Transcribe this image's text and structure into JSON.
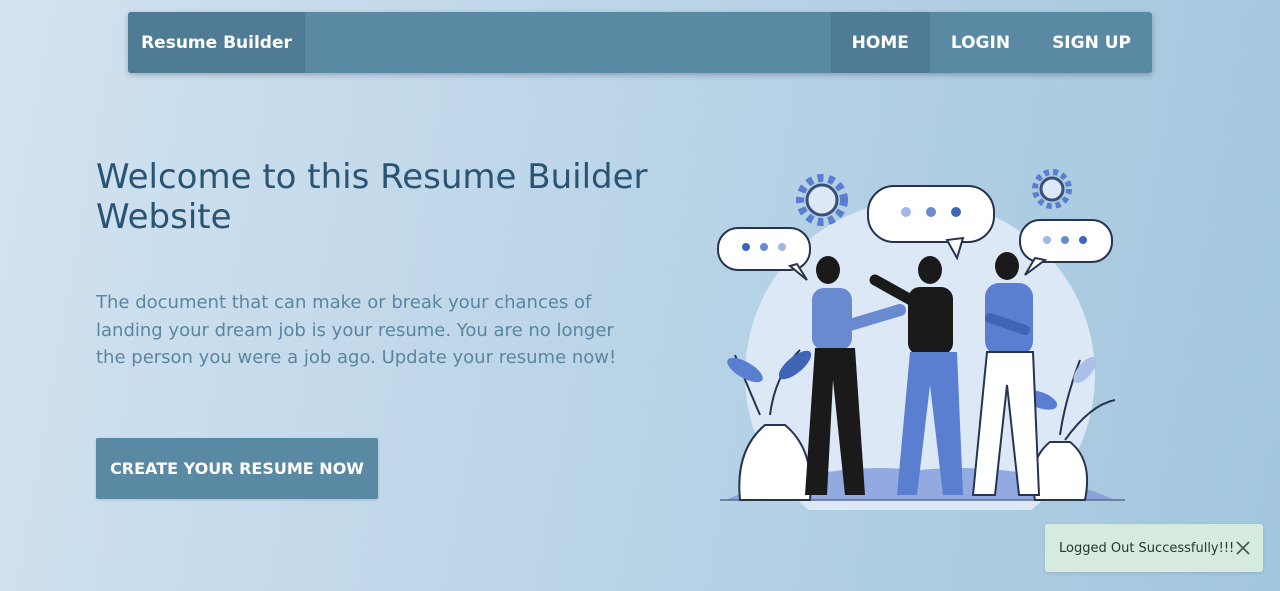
{
  "navbar": {
    "brand": "Resume Builder",
    "links": [
      {
        "label": "HOME",
        "active": true
      },
      {
        "label": "LOGIN",
        "active": false
      },
      {
        "label": "SIGN UP",
        "active": false
      }
    ]
  },
  "hero": {
    "title": "Welcome to this Resume Builder Website",
    "description": "The document that can make or break your chances of landing your dream job is your resume. You are no longer the person you were a job ago. Update your resume now!",
    "cta_label": "CREATE YOUR RESUME NOW"
  },
  "toast": {
    "message": "Logged Out Successfully!!!",
    "close_icon": "close-icon"
  },
  "colors": {
    "navbar": "#5a8aa3",
    "navbar_active": "#4f7c94",
    "title": "#2a5473",
    "description": "#5a86a0",
    "toast_bg": "#d6ebe0",
    "illustration_blue": "#5a7fd0"
  },
  "illustration": {
    "icons": [
      "gear-icon",
      "speech-bubble-icon",
      "person-icon",
      "plant-vase-icon"
    ]
  }
}
